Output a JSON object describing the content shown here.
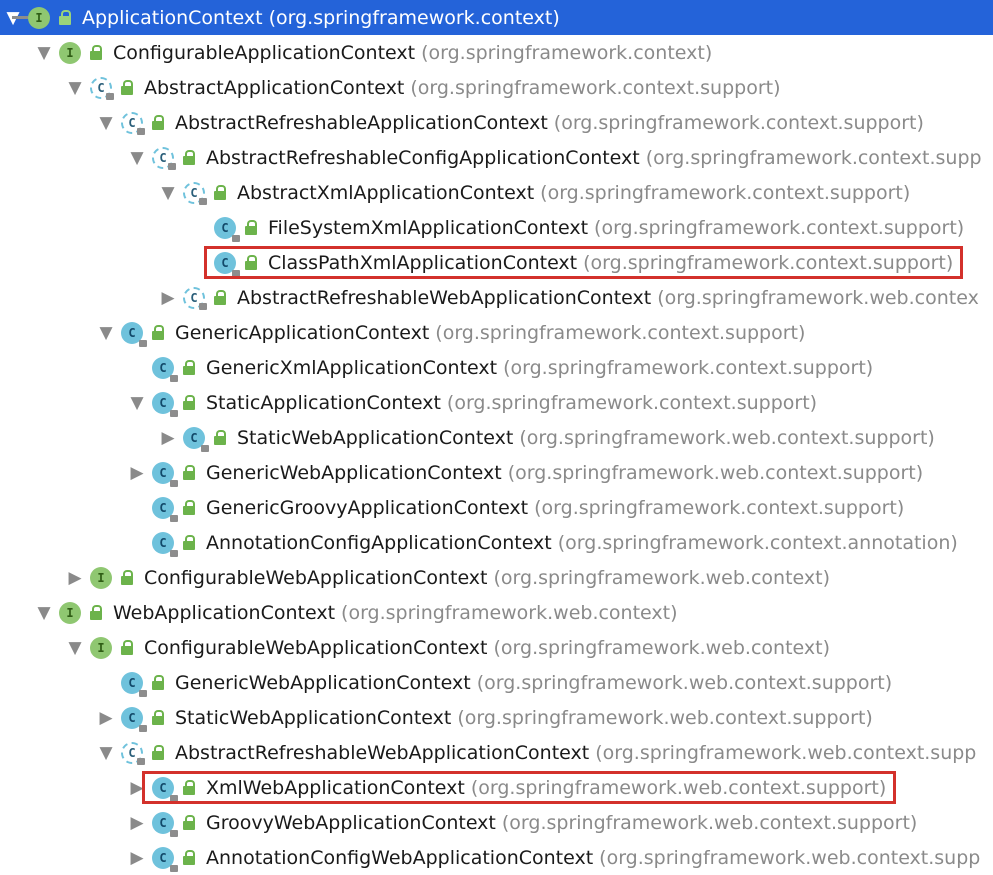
{
  "tree": {
    "items": [
      {
        "depth": 0,
        "toggle": "▼",
        "kind": "I",
        "abstract": false,
        "name": "ApplicationContext",
        "pkg": "(org.springframework.context)",
        "selected": true,
        "stem": true
      },
      {
        "depth": 1,
        "toggle": "▼",
        "kind": "I",
        "abstract": false,
        "name": "ConfigurableApplicationContext",
        "pkg": "(org.springframework.context)"
      },
      {
        "depth": 2,
        "toggle": "▼",
        "kind": "C",
        "abstract": true,
        "name": "AbstractApplicationContext",
        "pkg": "(org.springframework.context.support)"
      },
      {
        "depth": 3,
        "toggle": "▼",
        "kind": "C",
        "abstract": true,
        "name": "AbstractRefreshableApplicationContext",
        "pkg": "(org.springframework.context.support)"
      },
      {
        "depth": 4,
        "toggle": "▼",
        "kind": "C",
        "abstract": true,
        "name": "AbstractRefreshableConfigApplicationContext",
        "pkg": "(org.springframework.context.supp"
      },
      {
        "depth": 5,
        "toggle": "▼",
        "kind": "C",
        "abstract": true,
        "name": "AbstractXmlApplicationContext",
        "pkg": "(org.springframework.context.support)"
      },
      {
        "depth": 6,
        "toggle": "",
        "kind": "C",
        "abstract": false,
        "name": "FileSystemXmlApplicationContext",
        "pkg": "(org.springframework.context.support)"
      },
      {
        "depth": 6,
        "toggle": "",
        "kind": "C",
        "abstract": false,
        "name": "ClassPathXmlApplicationContext",
        "pkg": "(org.springframework.context.support)",
        "highlight": true
      },
      {
        "depth": 5,
        "toggle": "▶",
        "kind": "C",
        "abstract": true,
        "name": "AbstractRefreshableWebApplicationContext",
        "pkg": "(org.springframework.web.contex"
      },
      {
        "depth": 3,
        "toggle": "▼",
        "kind": "C",
        "abstract": false,
        "name": "GenericApplicationContext",
        "pkg": "(org.springframework.context.support)"
      },
      {
        "depth": 4,
        "toggle": "",
        "kind": "C",
        "abstract": false,
        "name": "GenericXmlApplicationContext",
        "pkg": "(org.springframework.context.support)"
      },
      {
        "depth": 4,
        "toggle": "▼",
        "kind": "C",
        "abstract": false,
        "name": "StaticApplicationContext",
        "pkg": "(org.springframework.context.support)"
      },
      {
        "depth": 5,
        "toggle": "▶",
        "kind": "C",
        "abstract": false,
        "name": "StaticWebApplicationContext",
        "pkg": "(org.springframework.web.context.support)"
      },
      {
        "depth": 4,
        "toggle": "▶",
        "kind": "C",
        "abstract": false,
        "name": "GenericWebApplicationContext",
        "pkg": "(org.springframework.web.context.support)"
      },
      {
        "depth": 4,
        "toggle": "",
        "kind": "C",
        "abstract": false,
        "name": "GenericGroovyApplicationContext",
        "pkg": "(org.springframework.context.support)"
      },
      {
        "depth": 4,
        "toggle": "",
        "kind": "C",
        "abstract": false,
        "name": "AnnotationConfigApplicationContext",
        "pkg": "(org.springframework.context.annotation)"
      },
      {
        "depth": 2,
        "toggle": "▶",
        "kind": "I",
        "abstract": false,
        "name": "ConfigurableWebApplicationContext",
        "pkg": "(org.springframework.web.context)"
      },
      {
        "depth": 1,
        "toggle": "▼",
        "kind": "I",
        "abstract": false,
        "name": "WebApplicationContext",
        "pkg": "(org.springframework.web.context)"
      },
      {
        "depth": 2,
        "toggle": "▼",
        "kind": "I",
        "abstract": false,
        "name": "ConfigurableWebApplicationContext",
        "pkg": "(org.springframework.web.context)"
      },
      {
        "depth": 3,
        "toggle": "",
        "kind": "C",
        "abstract": false,
        "name": "GenericWebApplicationContext",
        "pkg": "(org.springframework.web.context.support)"
      },
      {
        "depth": 3,
        "toggle": "▶",
        "kind": "C",
        "abstract": false,
        "name": "StaticWebApplicationContext",
        "pkg": "(org.springframework.web.context.support)"
      },
      {
        "depth": 3,
        "toggle": "▼",
        "kind": "C",
        "abstract": true,
        "name": "AbstractRefreshableWebApplicationContext",
        "pkg": "(org.springframework.web.context.supp"
      },
      {
        "depth": 4,
        "toggle": "▶",
        "kind": "C",
        "abstract": false,
        "name": "XmlWebApplicationContext",
        "pkg": "(org.springframework.web.context.support)",
        "highlight": true
      },
      {
        "depth": 4,
        "toggle": "▶",
        "kind": "C",
        "abstract": false,
        "name": "GroovyWebApplicationContext",
        "pkg": "(org.springframework.web.context.support)"
      },
      {
        "depth": 4,
        "toggle": "▶",
        "kind": "C",
        "abstract": false,
        "name": "AnnotationConfigWebApplicationContext",
        "pkg": "(org.springframework.web.context.supp"
      }
    ]
  }
}
